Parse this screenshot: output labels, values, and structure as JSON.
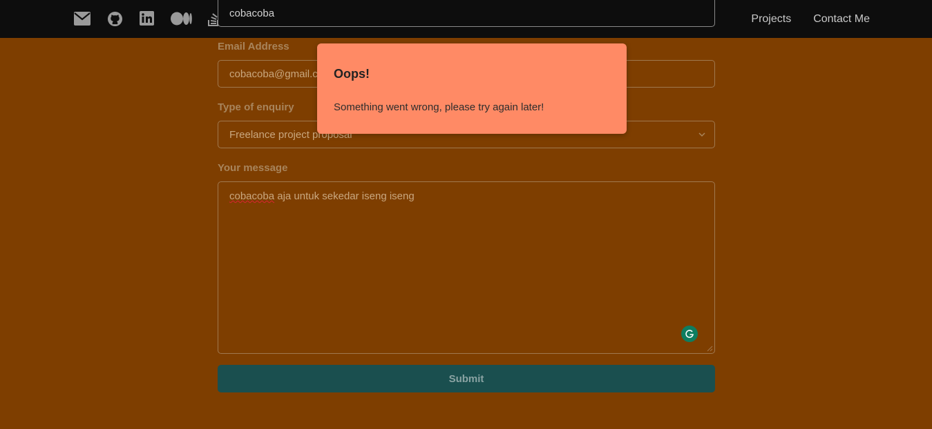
{
  "nav": {
    "social_icons": [
      "mail-icon",
      "github-icon",
      "linkedin-icon",
      "medium-icon",
      "stackoverflow-icon"
    ],
    "links": [
      "Projects",
      "Contact Me"
    ]
  },
  "form": {
    "name_value": "cobacoba",
    "email_label": "Email Address",
    "email_value": "cobacoba@gmail.com",
    "enquiry_label": "Type of enquiry",
    "enquiry_selected": "Freelance project proposal",
    "message_label": "Your message",
    "message_first_word": "cobacoba",
    "message_rest": " aja untuk sekedar iseng iseng",
    "submit_label": "Submit"
  },
  "toast": {
    "title": "Oops!",
    "message": "Something went wrong, please try again later!"
  },
  "colors": {
    "background": "#7e3e00",
    "navbar": "#0d0d0d",
    "toast": "#ff8a65",
    "submit": "#1a4f4f"
  }
}
